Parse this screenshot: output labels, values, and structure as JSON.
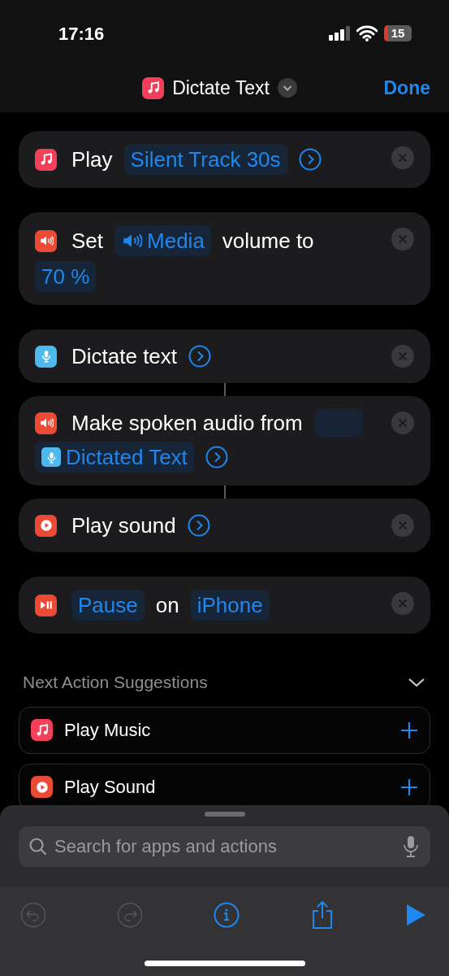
{
  "status_bar": {
    "time": "17:16",
    "battery": "15"
  },
  "header": {
    "title": "Dictate Text",
    "action": "Done"
  },
  "actions": [
    {
      "kind": "music",
      "color": "#f2405a",
      "linked_to_next": false,
      "parts": [
        {
          "kind": "text",
          "text": "Play"
        },
        {
          "kind": "token",
          "text": "Silent Track 30s"
        },
        {
          "kind": "chevron"
        }
      ]
    },
    {
      "kind": "speaker",
      "color": "#ea4a36",
      "linked_to_next": false,
      "parts": [
        {
          "kind": "text",
          "text": "Set"
        },
        {
          "kind": "token-speaker",
          "text": "Media"
        },
        {
          "kind": "text",
          "text": "volume to"
        },
        {
          "kind": "token",
          "text": "70 %"
        }
      ]
    },
    {
      "kind": "mic",
      "color": "#4fb9ee",
      "linked_to_next": true,
      "parts": [
        {
          "kind": "text",
          "text": "Dictate text"
        },
        {
          "kind": "chevron"
        }
      ]
    },
    {
      "kind": "speaker",
      "color": "#ea4a36",
      "linked_to_next": true,
      "parts": [
        {
          "kind": "text",
          "text": "Make spoken audio from"
        },
        {
          "kind": "blank"
        },
        {
          "kind": "token-mic",
          "text": "Dictated Text"
        },
        {
          "kind": "chevron"
        }
      ]
    },
    {
      "kind": "play",
      "color": "#ea4a36",
      "linked_to_next": false,
      "parts": [
        {
          "kind": "text",
          "text": "Play sound"
        },
        {
          "kind": "chevron"
        }
      ]
    },
    {
      "kind": "playpause",
      "color": "#ea4a36",
      "linked_to_next": false,
      "parts": [
        {
          "kind": "token",
          "text": "Pause"
        },
        {
          "kind": "text",
          "text": "on"
        },
        {
          "kind": "token",
          "text": "iPhone"
        }
      ]
    }
  ],
  "suggestions": {
    "title": "Next Action Suggestions",
    "expanded": true,
    "items": [
      {
        "kind": "music",
        "color": "#f2405a",
        "label": "Play Music"
      },
      {
        "kind": "play",
        "color": "#ea4a36",
        "label": "Play Sound"
      }
    ]
  },
  "search": {
    "placeholder": "Search for apps and actions"
  },
  "toolbar": [
    {
      "kind": "undo",
      "disabled": true
    },
    {
      "kind": "redo",
      "disabled": true
    },
    {
      "kind": "info",
      "disabled": false
    },
    {
      "kind": "share",
      "disabled": false
    },
    {
      "kind": "run",
      "disabled": false
    }
  ]
}
